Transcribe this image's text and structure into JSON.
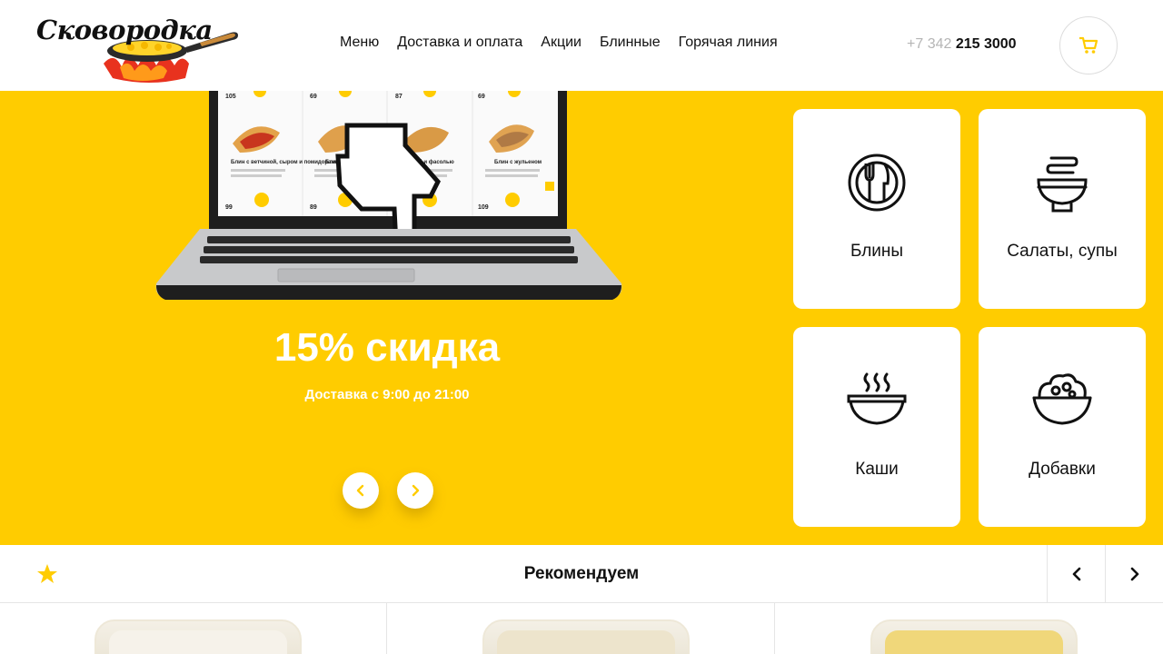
{
  "brand": {
    "name": "Сковородка"
  },
  "nav": {
    "items": [
      {
        "label": "Меню"
      },
      {
        "label": "Доставка и оплата"
      },
      {
        "label": "Акции"
      },
      {
        "label": "Блинные"
      },
      {
        "label": "Горячая линия"
      }
    ]
  },
  "contact": {
    "phone_code": "+7 342",
    "phone_number": "215 3000"
  },
  "cart": {
    "icon": "cart-icon"
  },
  "hero": {
    "title": "15% скидка",
    "subtitle": "Доставка с 9:00 до 21:00",
    "laptop_screen": {
      "prices_top": [
        "105",
        "69",
        "87",
        "69"
      ],
      "item_names": [
        "Блин с ветчиной, сыром и помидорами",
        "Блин",
        "…цей и фасолью",
        "Блин с жульеном"
      ],
      "prices_bottom": [
        "99",
        "89",
        "",
        "109"
      ]
    }
  },
  "categories": [
    {
      "label": "Блины",
      "icon": "plate-fork-knife-icon"
    },
    {
      "label": "Салаты, супы",
      "icon": "salad-bowl-icon"
    },
    {
      "label": "Каши",
      "icon": "steaming-bowl-icon"
    },
    {
      "label": "Добавки",
      "icon": "filled-bowl-icon"
    }
  ],
  "recommend": {
    "title": "Рекомендуем"
  },
  "colors": {
    "accent": "#ffcc00",
    "text": "#111111",
    "muted": "#b5b5b5"
  }
}
